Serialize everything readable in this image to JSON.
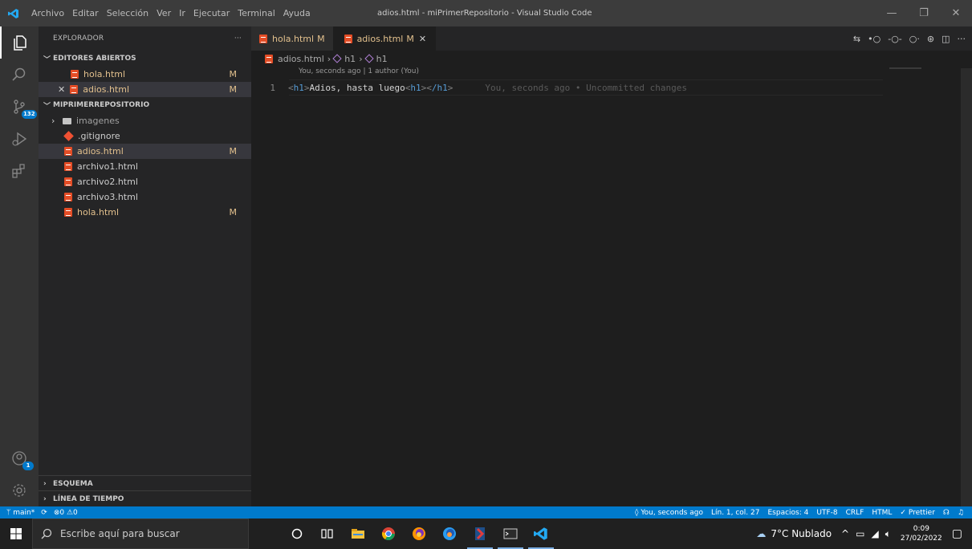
{
  "titlebar": {
    "menu": [
      "Archivo",
      "Editar",
      "Selección",
      "Ver",
      "Ir",
      "Ejecutar",
      "Terminal",
      "Ayuda"
    ],
    "title": "adios.html - miPrimerRepositorio - Visual Studio Code",
    "minimize": "—",
    "restore": "❐",
    "close": "✕"
  },
  "activity": {
    "source_control_badge": "132",
    "accounts_badge": "1"
  },
  "sidebar": {
    "header": "EXPLORADOR",
    "more": "···",
    "open_editors": {
      "title": "EDITORES ABIERTOS",
      "items": [
        {
          "name": "hola.html",
          "status": "M"
        },
        {
          "name": "adios.html",
          "status": "M",
          "close": "✕"
        }
      ]
    },
    "repo": {
      "title": "MIPRIMERREPOSITORIO",
      "folder": "imagenes",
      "items": [
        {
          "name": ".gitignore",
          "status": ""
        },
        {
          "name": "adios.html",
          "status": "M"
        },
        {
          "name": "archivo1.html",
          "status": ""
        },
        {
          "name": "archivo2.html",
          "status": ""
        },
        {
          "name": "archivo3.html",
          "status": ""
        },
        {
          "name": "hola.html",
          "status": "M"
        }
      ]
    },
    "outline": "ESQUEMA",
    "timeline": "LÍNEA DE TIEMPO"
  },
  "tabs": [
    {
      "label": "hola.html",
      "status": "M"
    },
    {
      "label": "adios.html",
      "status": "M",
      "close": "✕"
    }
  ],
  "breadcrumb": {
    "file": "adios.html",
    "sym1": "h1",
    "sym2": "h1"
  },
  "editor": {
    "codelens": "You, seconds ago | 1 author (You)",
    "line_number": "1",
    "code_open_tag": "h1",
    "code_text": "Adios, hasta luego",
    "code_mid_tag": "h1",
    "code_close_tag": "/h1",
    "blame": "You, seconds ago • Uncommitted changes"
  },
  "statusbar": {
    "branch": "main*",
    "errors": "0",
    "warnings": "0",
    "blame": "You, seconds ago",
    "position": "Lín. 1, col. 27",
    "spaces": "Espacios: 4",
    "encoding": "UTF-8",
    "eol": "CRLF",
    "language": "HTML",
    "prettier": "Prettier"
  },
  "taskbar": {
    "search_placeholder": "Escribe aquí para buscar",
    "weather": "7°C  Nublado",
    "time": "0:09",
    "date": "27/02/2022"
  },
  "colors": {
    "accent": "#007acc",
    "modified": "#e2c08d",
    "html_icon": "#e44d26"
  }
}
